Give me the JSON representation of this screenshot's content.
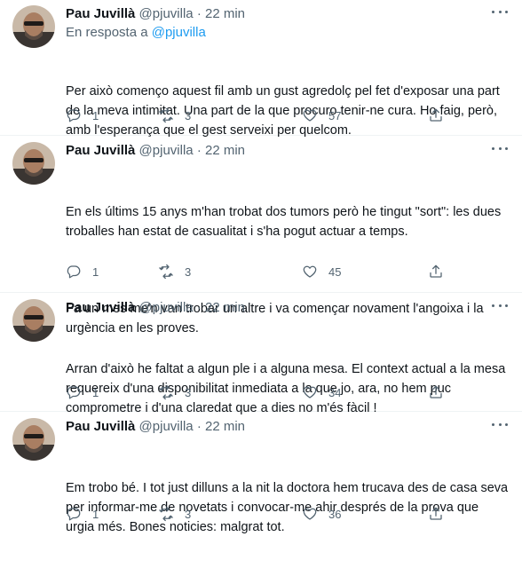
{
  "tweets": [
    {
      "name": "Pau Juvillà",
      "handle": "@pjuvilla",
      "sep": "·",
      "time": "22 min",
      "reply_prefix": "En resposta a",
      "reply_to": "@pjuvilla",
      "paragraphs": [
        "Per això començo aquest fil amb un gust agredolç pel fet d'exposar una part de la meva intimitat. Una part de la que procuro tenir-ne cura. Ho faig, però, amb l'esperança que el gest serveixi per quelcom."
      ],
      "replies": "1",
      "retweets": "3",
      "likes": "57"
    },
    {
      "name": "Pau Juvillà",
      "handle": "@pjuvilla",
      "sep": "·",
      "time": "22 min",
      "paragraphs": [
        "En els últims 15 anys m'han trobat dos tumors però he tingut \"sort\": les dues troballes han estat de casualitat i s'ha pogut actuar a temps.",
        "Fa un mes me'n van trobar un altre i va començar novament l'angoixa i la urgència en les proves."
      ],
      "replies": "1",
      "retweets": "3",
      "likes": "45"
    },
    {
      "name": "Pau Juvillà",
      "handle": "@pjuvilla",
      "sep": "·",
      "time": "22 min",
      "paragraphs": [
        "Arran d'això he faltat a algun ple i a alguna mesa. El context actual a la mesa requereix d'una disponibilitat inmediata a la que jo, ara, no hem puc comprometre i d'una claredat que a dies no m'és fàcil !"
      ],
      "replies": "1",
      "retweets": "3",
      "likes": "34"
    },
    {
      "name": "Pau Juvillà",
      "handle": "@pjuvilla",
      "sep": "·",
      "time": "22 min",
      "paragraphs": [
        "Em trobo bé. I tot just dilluns a la nit la doctora hem trucava des de casa seva per informar-me de novetats i convocar-me ahir després de la prova que urgia més. Bones noticies: malgrat tot."
      ],
      "replies": "1",
      "retweets": "3",
      "likes": "36"
    }
  ],
  "icons": {
    "reply": "reply-icon",
    "retweet": "retweet-icon",
    "like": "heart-icon",
    "share": "share-icon",
    "more": "more-icon"
  },
  "colors": {
    "text": "#0f1419",
    "secondary": "#536471",
    "link": "#1d9bf0",
    "divider": "#eff3f4"
  }
}
